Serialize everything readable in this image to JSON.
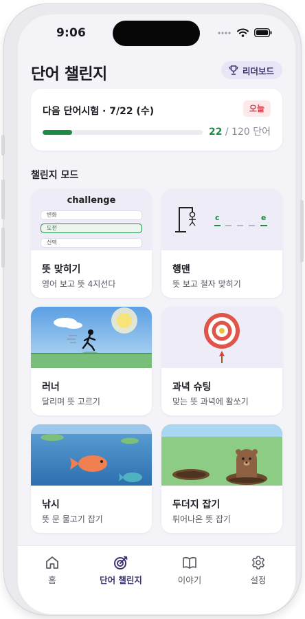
{
  "status": {
    "time": "9:06"
  },
  "header": {
    "title": "단어 챌린지",
    "leaderboard_label": "리더보드"
  },
  "test": {
    "title": "다음 단어시험 · 7/22 (수)",
    "badge": "오늘",
    "current": "22",
    "total_text": " / 120 단어",
    "progress_fraction": 0.183
  },
  "section": {
    "title": "챌린지 모드"
  },
  "modes": [
    {
      "name": "뜻 맞히기",
      "desc": "영어 보고 뜻 4지선다",
      "illust_word": "challenge",
      "options": [
        "변화",
        "도전",
        "선택"
      ]
    },
    {
      "name": "행맨",
      "desc": "뜻 보고 철자 맞히기",
      "letter_first": "c",
      "letter_last": "e"
    },
    {
      "name": "러너",
      "desc": "달리며 뜻 고르기"
    },
    {
      "name": "과녁 슈팅",
      "desc": "맞는 뜻 과녁에 활쏘기"
    },
    {
      "name": "낚시",
      "desc": "뜻 문 물고기 잡기"
    },
    {
      "name": "두더지 잡기",
      "desc": "튀어나온 뜻 잡기"
    }
  ],
  "tabs": [
    {
      "label": "홈",
      "icon": "home-icon"
    },
    {
      "label": "단어 챌린지",
      "icon": "target-icon",
      "active": true
    },
    {
      "label": "이야기",
      "icon": "book-icon"
    },
    {
      "label": "설정",
      "icon": "gear-icon"
    }
  ],
  "colors": {
    "accent": "#3b3570",
    "progress": "#1e8a46",
    "today_badge": "#d63c4a"
  }
}
